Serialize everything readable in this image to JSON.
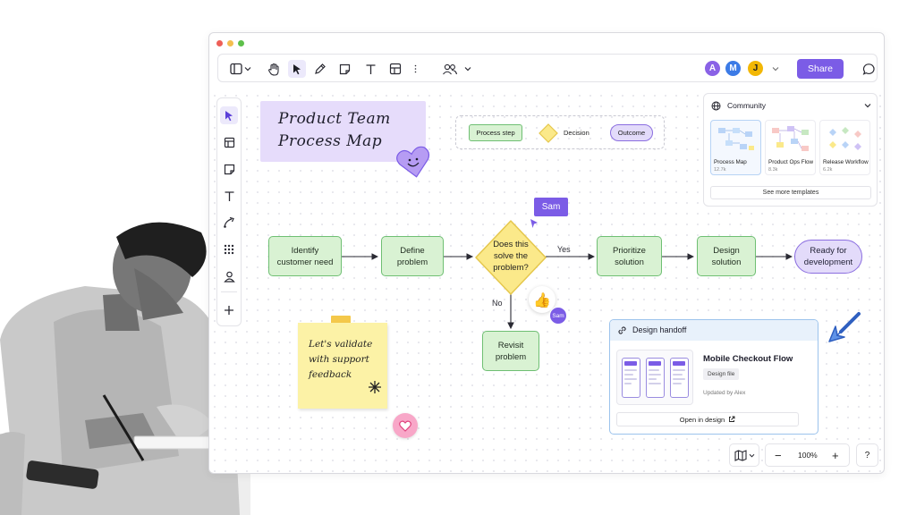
{
  "window": {
    "dots": [
      "#ee5f57",
      "#f4be4f",
      "#5ec04a"
    ]
  },
  "toolbar": {
    "icons": [
      "layout-icon",
      "chevron-down-icon",
      "hand-icon",
      "pointer-icon",
      "pen-icon",
      "sticky-note-icon",
      "text-icon",
      "table-icon",
      "more-icon",
      "users-icon",
      "chevron-down-icon"
    ],
    "avatars": [
      {
        "label": "A",
        "color": "#8a62e6"
      },
      {
        "label": "M",
        "color": "#3c7be6"
      },
      {
        "label": "J",
        "color": "#f2b705"
      }
    ],
    "share_label": "Share"
  },
  "left_tools": [
    "pointer-icon",
    "frame-icon",
    "sticky-note-icon",
    "text-icon",
    "connector-icon",
    "apps-icon",
    "person-icon",
    "add-icon"
  ],
  "title_card": {
    "line1": "Product Team",
    "line2": "Process Map"
  },
  "legend": {
    "process_step": "Process step",
    "decision": "Decision",
    "outcome": "Outcome"
  },
  "flow": {
    "identify": {
      "line1": "Identify",
      "line2": "customer need"
    },
    "define": {
      "line1": "Define",
      "line2": "problem"
    },
    "decision": {
      "line1": "Does this",
      "line2": "solve the",
      "line3": "problem?"
    },
    "prioritize": {
      "line1": "Prioritize",
      "line2": "solution"
    },
    "design": {
      "line1": "Design",
      "line2": "solution"
    },
    "ready": {
      "line1": "Ready for",
      "line2": "development"
    },
    "revisit": {
      "line1": "Revisit",
      "line2": "problem"
    },
    "yes_label": "Yes",
    "no_label": "No"
  },
  "cursor_tag": {
    "name": "Sam"
  },
  "reaction": {
    "emoji": "👍",
    "user": "Sam"
  },
  "sticky": {
    "line1": "Let's validate",
    "line2": "with support",
    "line3": "feedback"
  },
  "community": {
    "title": "Community",
    "templates": [
      {
        "name": "Process Map",
        "count": "12.7k"
      },
      {
        "name": "Product Ops Flow",
        "count": "8.3k"
      },
      {
        "name": "Release Workflow",
        "count": "6.2k"
      }
    ],
    "see_more": "See more templates"
  },
  "handoff": {
    "header": "Design handoff",
    "title": "Mobile Checkout Flow",
    "badge": "Design file",
    "updated": "Updated by Alex",
    "open_label": "Open in design"
  },
  "zoom": {
    "level": "100%",
    "minus": "−",
    "plus": "+",
    "help": "?"
  },
  "colors": {
    "accent": "#7b5ce6",
    "process": "#d9f2d3",
    "decision": "#fbe98a",
    "outcome": "#e3dbfa"
  }
}
